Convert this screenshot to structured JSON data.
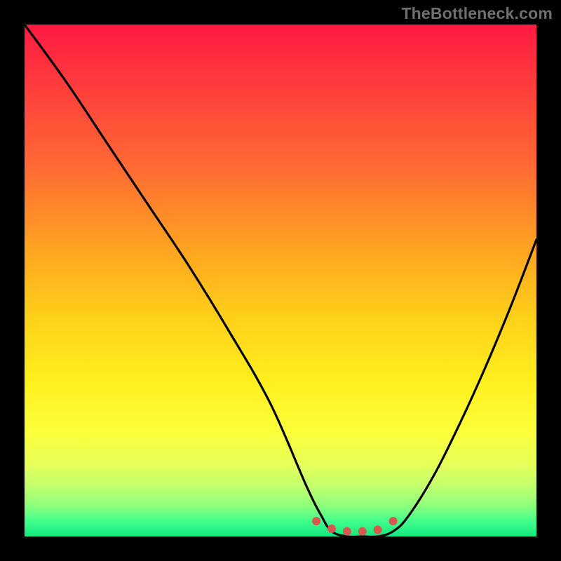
{
  "watermark": "TheBottleneck.com",
  "chart_data": {
    "type": "line",
    "title": "",
    "xlabel": "",
    "ylabel": "",
    "xlim": [
      0,
      100
    ],
    "ylim": [
      0,
      100
    ],
    "grid": false,
    "legend": false,
    "series": [
      {
        "name": "bottleneck-curve",
        "x": [
          0,
          8,
          16,
          24,
          32,
          40,
          48,
          55,
          58,
          60,
          63,
          66,
          69,
          72,
          75,
          80,
          85,
          90,
          95,
          100
        ],
        "values": [
          100,
          89,
          77,
          65,
          53,
          40,
          26,
          10,
          4,
          1,
          0,
          0,
          0,
          1,
          4,
          12,
          22,
          33,
          45,
          58
        ]
      }
    ],
    "markers": [
      {
        "name": "range-start",
        "x": 57,
        "y": 3,
        "color": "#d5594f",
        "r": 6
      },
      {
        "name": "range-dot-1",
        "x": 60,
        "y": 1.5,
        "color": "#d5594f",
        "r": 6
      },
      {
        "name": "range-dot-2",
        "x": 63,
        "y": 1,
        "color": "#d5594f",
        "r": 6
      },
      {
        "name": "range-dot-3",
        "x": 66,
        "y": 1,
        "color": "#d5594f",
        "r": 6
      },
      {
        "name": "range-dot-4",
        "x": 69,
        "y": 1.3,
        "color": "#d5594f",
        "r": 6
      },
      {
        "name": "range-end",
        "x": 72,
        "y": 3,
        "color": "#d5594f",
        "r": 6
      }
    ],
    "colors": {
      "curve": "#000000",
      "marker": "#d5594f",
      "gradient_top": "#ff1a42",
      "gradient_mid": "#ffe01a",
      "gradient_bottom": "#12e87e"
    }
  }
}
